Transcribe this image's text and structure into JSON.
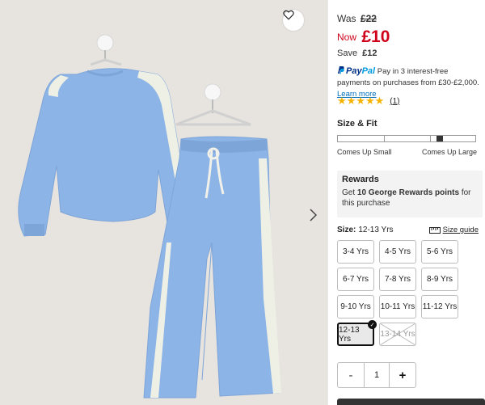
{
  "image": {
    "product_alt": "Blue tracksuit sweatshirt and wide leg joggers on hangers",
    "wishlist_icon": "heart-icon",
    "next_icon": "chevron-right-icon"
  },
  "price": {
    "was_label": "Was",
    "was_value": "£22",
    "now_label": "Now",
    "now_value": "£10",
    "save_label": "Save",
    "save_value": "£12"
  },
  "paypal": {
    "logo_pay": "Pay",
    "logo_pal": "Pal",
    "text": "Pay in 3 interest-free payments on purchases from £30-£2,000.",
    "link": "Learn more"
  },
  "rating": {
    "stars": "★★★★★",
    "count": "(1)"
  },
  "size_fit": {
    "title": "Size & Fit",
    "left_label": "Comes Up Small",
    "right_label": "Comes Up Large",
    "level": 0.75
  },
  "rewards": {
    "title": "Rewards",
    "text_prefix": "Get ",
    "points": "10 George Rewards points",
    "text_suffix": " for this purchase"
  },
  "size": {
    "label": "Size:",
    "selected": "12-13 Yrs",
    "guide": "Size guide",
    "options": [
      {
        "label": "3-4 Yrs"
      },
      {
        "label": "4-5 Yrs"
      },
      {
        "label": "5-6 Yrs"
      },
      {
        "label": "6-7 Yrs"
      },
      {
        "label": "7-8 Yrs"
      },
      {
        "label": "8-9 Yrs"
      },
      {
        "label": "9-10 Yrs"
      },
      {
        "label": "10-11 Yrs"
      },
      {
        "label": "11-12 Yrs"
      },
      {
        "label": "12-13 Yrs"
      },
      {
        "label": "13-14 Yrs"
      }
    ]
  },
  "quantity": {
    "minus": "-",
    "value": "1",
    "plus": "+"
  },
  "colors": {
    "price_red": "#d0021b",
    "star_gold": "#f5b301",
    "paypal_blue": "#003087",
    "garment_blue": "#8db4e6"
  }
}
